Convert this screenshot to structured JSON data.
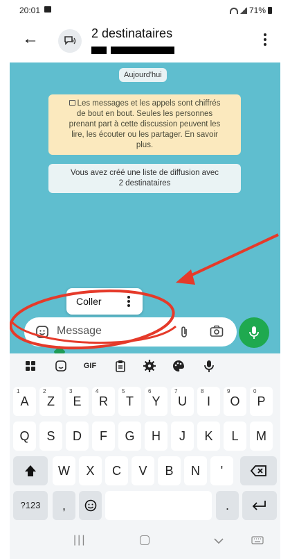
{
  "status_bar": {
    "time": "20:01",
    "battery": "71%"
  },
  "header": {
    "title": "2 destinataires"
  },
  "chat": {
    "date_chip": "Aujourd'hui",
    "encryption_notice": "Les messages et les appels sont chiffrés de bout en bout. Seules les personnes prenant part à cette discussion peuvent les lire, les écouter ou les partager. En savoir plus.",
    "encryption_lines": [
      "Les messages et les appels sont chiffrés",
      "de bout en bout. Seules les personnes",
      "prenant part à cette discussion peuvent les",
      "lire, les écouter ou les partager. En savoir",
      "plus."
    ],
    "system_lines": [
      "Vous avez créé une liste de diffusion avec",
      "2 destinataires"
    ]
  },
  "paste_popup": {
    "label": "Coller"
  },
  "composer": {
    "placeholder": "Message"
  },
  "keyboard": {
    "toolbar": [
      "apps-icon",
      "sticker-icon",
      "GIF",
      "clipboard-icon",
      "gear-icon",
      "palette-icon",
      "mic-icon"
    ],
    "gif_label": "GIF",
    "row1": [
      {
        "k": "A",
        "n": "1"
      },
      {
        "k": "Z",
        "n": "2"
      },
      {
        "k": "E",
        "n": "3"
      },
      {
        "k": "R",
        "n": "4"
      },
      {
        "k": "T",
        "n": "5"
      },
      {
        "k": "Y",
        "n": "6"
      },
      {
        "k": "U",
        "n": "7"
      },
      {
        "k": "I",
        "n": "8"
      },
      {
        "k": "O",
        "n": "9"
      },
      {
        "k": "P",
        "n": "0"
      }
    ],
    "row2": [
      "Q",
      "S",
      "D",
      "F",
      "G",
      "H",
      "J",
      "K",
      "L",
      "M"
    ],
    "row3": [
      "W",
      "X",
      "C",
      "V",
      "B",
      "N",
      "'"
    ],
    "bottom": {
      "symbols": "?123",
      "comma": ",",
      "period": "."
    }
  },
  "colors": {
    "chat_bg": "#5fbecf",
    "accent": "#1fa94f",
    "annotation": "#e53a2a",
    "notice_bg": "#fbe9be"
  }
}
